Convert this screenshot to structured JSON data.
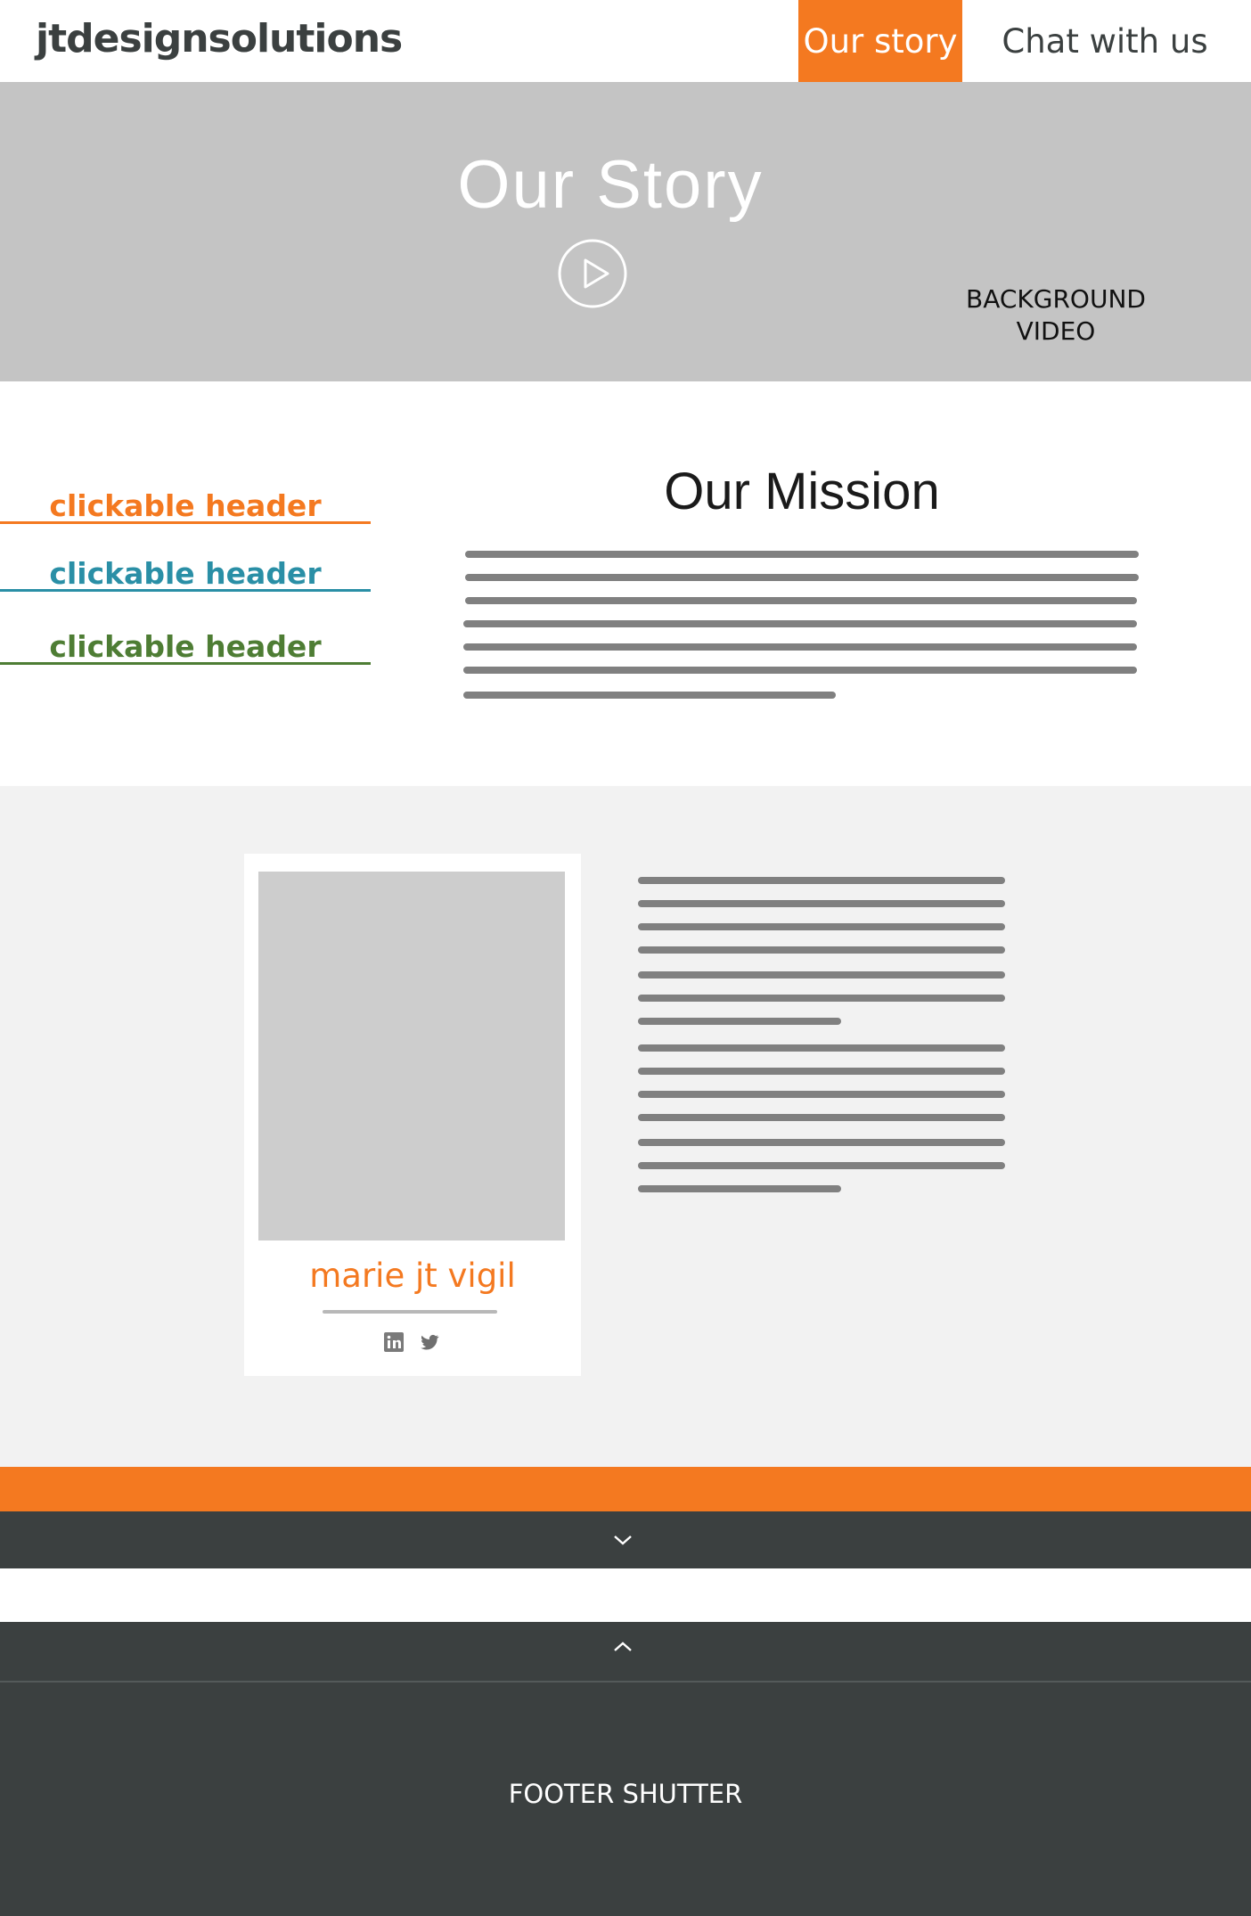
{
  "header": {
    "brand": "jtdesignsolutions",
    "nav": [
      {
        "label": "Our story",
        "active": true
      },
      {
        "label": "Chat with us",
        "active": false
      }
    ]
  },
  "hero": {
    "title": "Our Story",
    "play_icon": "play-circle-icon",
    "video_label_line1": "BACKGROUND",
    "video_label_line2": "VIDEO"
  },
  "sidebar": {
    "headers": [
      {
        "label": "clickable header",
        "color": "#f47920"
      },
      {
        "label": "clickable header",
        "color": "#2a8fa6"
      },
      {
        "label": "clickable header",
        "color": "#4e7d34"
      }
    ]
  },
  "mission": {
    "title": "Our Mission"
  },
  "profile": {
    "name": "marie jt vigil",
    "social_icons": [
      "linkedin-icon",
      "twitter-icon"
    ]
  },
  "footer": {
    "label": "FOOTER SHUTTER",
    "collapse_icon": "chevron-down-icon",
    "expand_icon": "chevron-up-icon"
  },
  "colors": {
    "accent": "#f47920",
    "dark": "#3b4040",
    "hero_bg": "#c4c4c4",
    "section_bg": "#f2f2f2"
  }
}
